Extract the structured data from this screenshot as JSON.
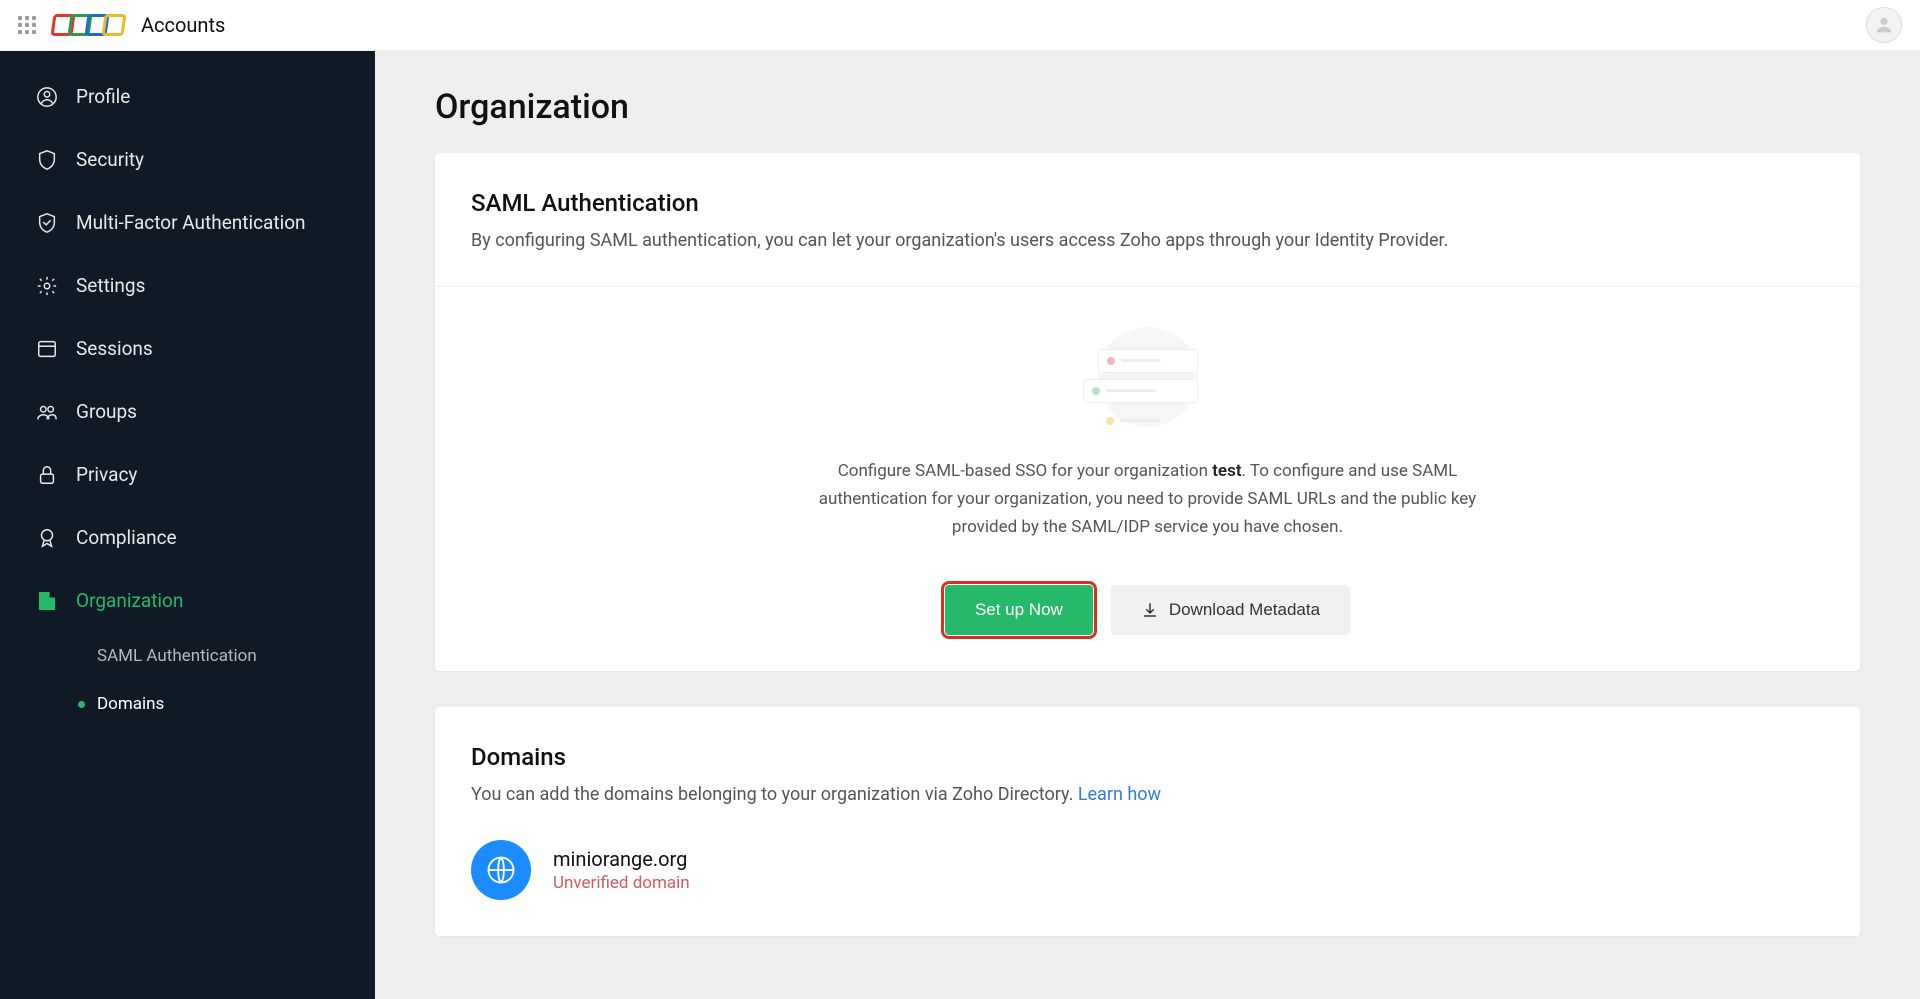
{
  "app_title": "Accounts",
  "page_title": "Organization",
  "sidebar": {
    "items": [
      {
        "label": "Profile"
      },
      {
        "label": "Security"
      },
      {
        "label": "Multi-Factor Authentication"
      },
      {
        "label": "Settings"
      },
      {
        "label": "Sessions"
      },
      {
        "label": "Groups"
      },
      {
        "label": "Privacy"
      },
      {
        "label": "Compliance"
      },
      {
        "label": "Organization"
      }
    ],
    "sub": [
      {
        "label": "SAML Authentication"
      },
      {
        "label": "Domains"
      }
    ]
  },
  "saml": {
    "title": "SAML Authentication",
    "desc": "By configuring SAML authentication, you can let your organization's users access Zoho apps through your Identity Provider.",
    "body_pre": "Configure SAML-based SSO for your organization ",
    "body_strong": "test",
    "body_post": ". To configure and use SAML authentication for your organization, you need to provide SAML URLs and the public key provided by the SAML/IDP service you have chosen.",
    "setup_btn": "Set up Now",
    "download_btn": "Download Metadata"
  },
  "domains": {
    "title": "Domains",
    "desc_text": "You can add the domains belonging to your organization via Zoho Directory. ",
    "learn_link": "Learn how",
    "item_name": "miniorange.org",
    "item_status": "Unverified domain"
  }
}
